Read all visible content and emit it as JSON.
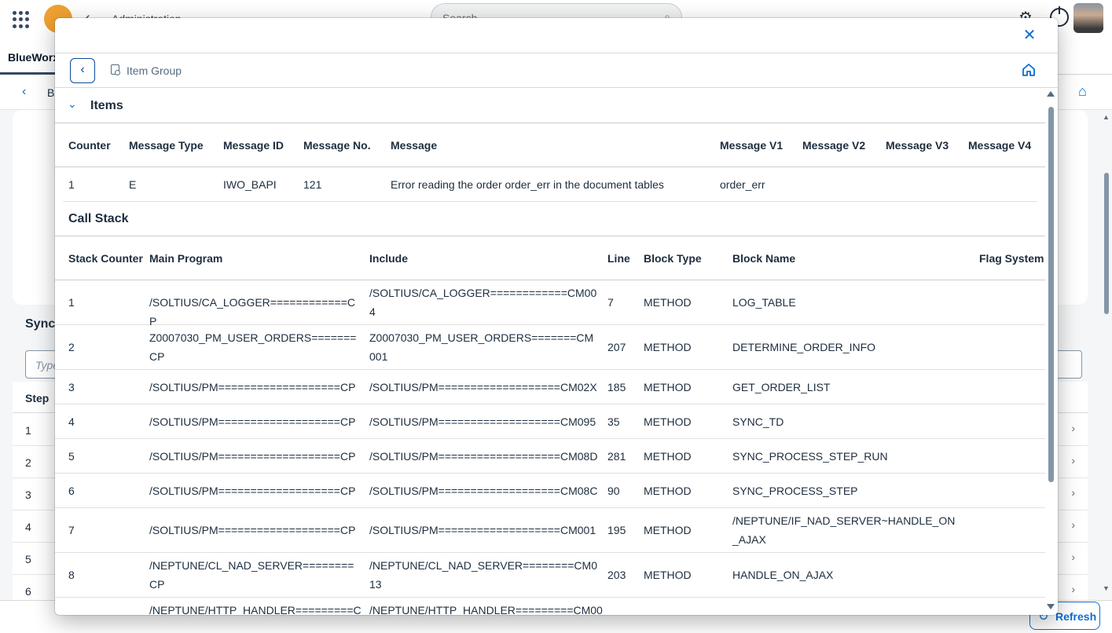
{
  "shell": {
    "title": "Administration",
    "search_placeholder": "Search",
    "search_icon": "search-icon",
    "app_tab": "BlueWorx",
    "subbar_text": "Bl"
  },
  "background": {
    "section_title": "Sync",
    "filter_placeholder": "Type",
    "table_header": "Step",
    "rows": [
      "1",
      "2",
      "3",
      "4",
      "5",
      "6"
    ],
    "refresh_label": "Refresh"
  },
  "dialog": {
    "breadcrumb": "Item Group",
    "items_section": {
      "title": "Items",
      "columns": [
        "Counter",
        "Message Type",
        "Message ID",
        "Message No.",
        "Message",
        "Message V1",
        "Message V2",
        "Message V3",
        "Message V4"
      ],
      "rows": [
        [
          "1",
          "E",
          "IWO_BAPI",
          "121",
          "Error reading the order order_err in the document tables",
          "order_err",
          "",
          "",
          ""
        ]
      ]
    },
    "call_stack": {
      "title": "Call Stack",
      "columns": [
        "Stack Counter",
        "Main Program",
        "Include",
        "Line",
        "Block Type",
        "Block Name",
        "Flag System"
      ],
      "rows": [
        [
          "1",
          "/SOLTIUS/CA_LOGGER============CP",
          "/SOLTIUS/CA_LOGGER============CM004",
          "7",
          "METHOD",
          "LOG_TABLE",
          ""
        ],
        [
          "2",
          "Z0007030_PM_USER_ORDERS=======CP",
          "Z0007030_PM_USER_ORDERS=======CM001",
          "207",
          "METHOD",
          "DETERMINE_ORDER_INFO",
          ""
        ],
        [
          "3",
          "/SOLTIUS/PM===================CP",
          "/SOLTIUS/PM===================CM02X",
          "185",
          "METHOD",
          "GET_ORDER_LIST",
          ""
        ],
        [
          "4",
          "/SOLTIUS/PM===================CP",
          "/SOLTIUS/PM===================CM095",
          "35",
          "METHOD",
          "SYNC_TD",
          ""
        ],
        [
          "5",
          "/SOLTIUS/PM===================CP",
          "/SOLTIUS/PM===================CM08D",
          "281",
          "METHOD",
          "SYNC_PROCESS_STEP_RUN",
          ""
        ],
        [
          "6",
          "/SOLTIUS/PM===================CP",
          "/SOLTIUS/PM===================CM08C",
          "90",
          "METHOD",
          "SYNC_PROCESS_STEP",
          ""
        ],
        [
          "7",
          "/SOLTIUS/PM===================CP",
          "/SOLTIUS/PM===================CM001",
          "195",
          "METHOD",
          "/NEPTUNE/IF_NAD_SERVER~HANDLE_ON_AJAX",
          ""
        ],
        [
          "8",
          "/NEPTUNE/CL_NAD_SERVER========CP",
          "/NEPTUNE/CL_NAD_SERVER========CM013",
          "203",
          "METHOD",
          "HANDLE_ON_AJAX",
          ""
        ],
        [
          "",
          "/NEPTUNE/HTTP_HANDLER=========C",
          "/NEPTUNE/HTTP_HANDLER=========CM00",
          "",
          "",
          "",
          ""
        ]
      ]
    }
  },
  "colors": {
    "accent": "#0a6ed1",
    "text": "#1d2d3e",
    "shell_logo": "#f0a132"
  }
}
